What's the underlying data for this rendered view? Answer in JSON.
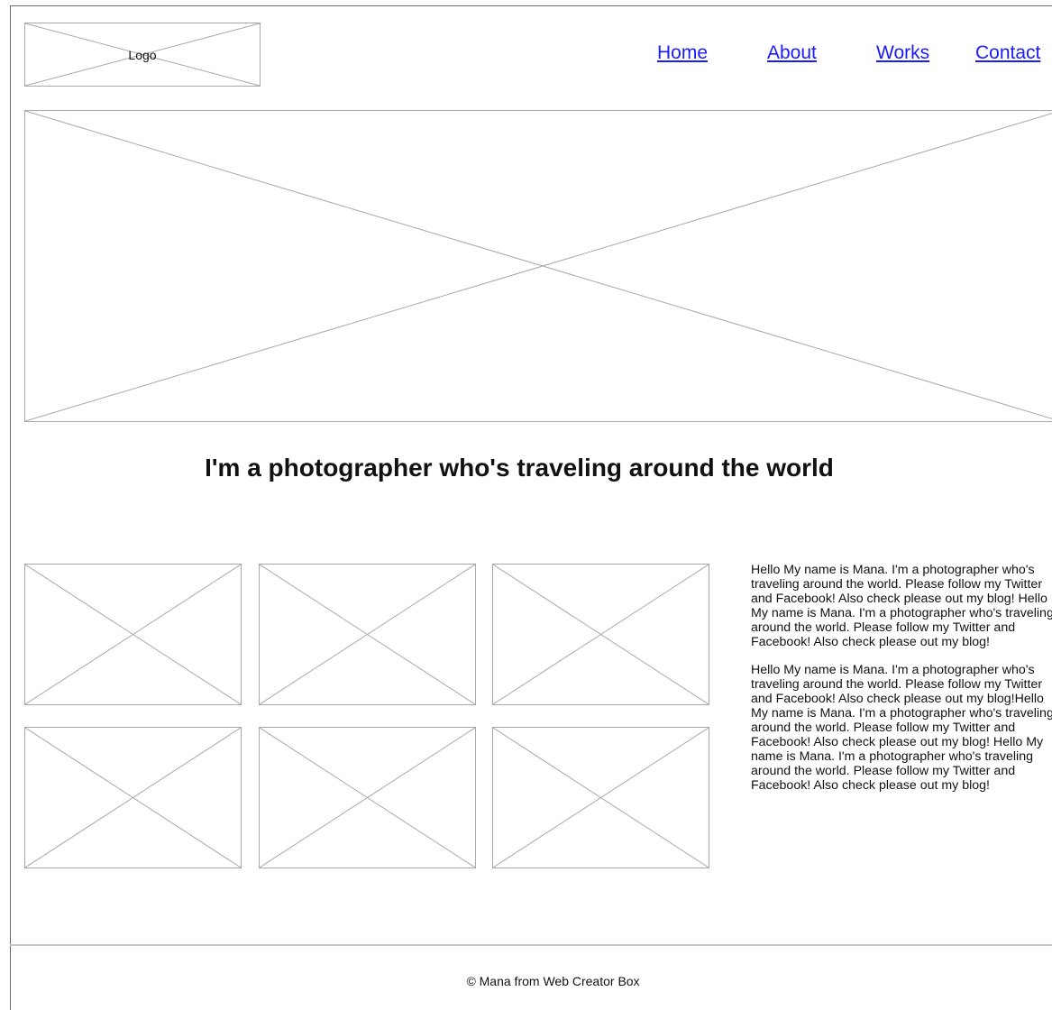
{
  "header": {
    "logo_label": "Logo",
    "nav": {
      "home": "Home",
      "about": "About",
      "works": "Works",
      "contact": "Contact"
    }
  },
  "main": {
    "headline": "I'm a photographer who's traveling around the world",
    "paragraphs": [
      "Hello My name is Mana. I'm a photographer who's traveling around the world. Please follow my Twitter and Facebook! Also check please out my blog! Hello My name is Mana. I'm a photographer who's traveling around the world. Please follow my Twitter and Facebook! Also check please out my blog!",
      "Hello My name is Mana. I'm a photographer who's traveling around the world. Please follow my Twitter and Facebook! Also check please out my blog!Hello My name is Mana. I'm a photographer who's traveling around the world. Please follow my Twitter and Facebook! Also check please out my blog! Hello My name is Mana. I'm a photographer who's traveling around the world. Please follow my Twitter and Facebook! Also check please out my blog!"
    ]
  },
  "footer": {
    "copyright": "© Mana from Web Creator Box"
  }
}
